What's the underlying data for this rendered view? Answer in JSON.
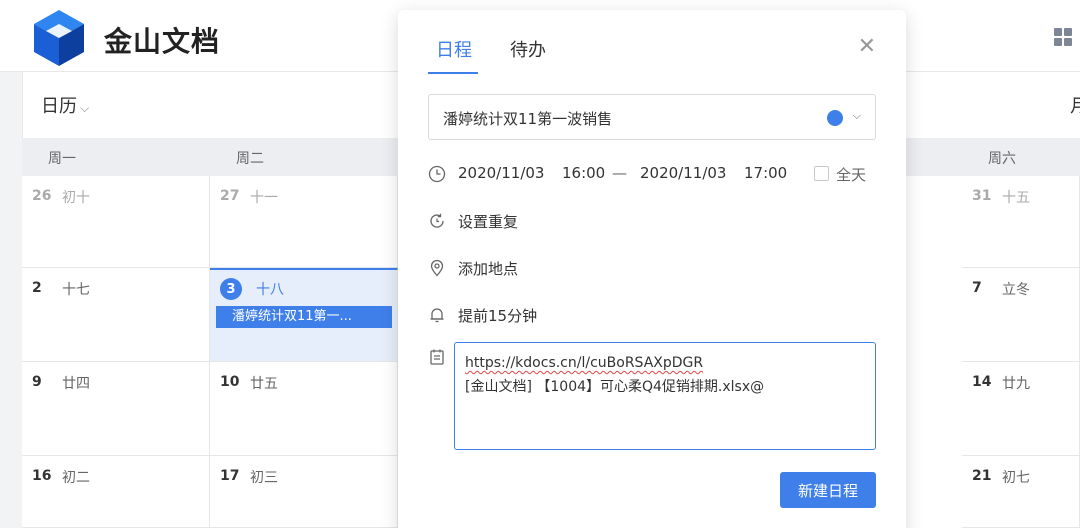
{
  "header": {
    "brand": "金山文档"
  },
  "calendar": {
    "view_label": "日历",
    "weekdays": [
      "周一",
      "周二",
      "周六"
    ],
    "right_edge_glyph": "月",
    "rows": [
      {
        "mon": {
          "date": "26",
          "lunar": "初十"
        },
        "tue": {
          "date": "27",
          "lunar": "十一"
        },
        "sat": {
          "date": "31",
          "lunar": "十五"
        }
      },
      {
        "mon": {
          "date": "2",
          "lunar": "十七"
        },
        "tue": {
          "date": "3",
          "lunar": "十八"
        },
        "sat": {
          "date": "7",
          "lunar": "立冬"
        }
      },
      {
        "mon": {
          "date": "9",
          "lunar": "廿四"
        },
        "tue": {
          "date": "10",
          "lunar": "廿五"
        },
        "sat": {
          "date": "14",
          "lunar": "廿九"
        }
      },
      {
        "mon": {
          "date": "16",
          "lunar": "初二"
        },
        "tue": {
          "date": "17",
          "lunar": "初三"
        },
        "sat": {
          "date": "21",
          "lunar": "初七"
        }
      }
    ],
    "event_chip": "潘婷统计双11第一..."
  },
  "dialog": {
    "tabs": [
      "日程",
      "待办"
    ],
    "title": "潘婷统计双11第一波销售",
    "start_date": "2020/11/03",
    "start_time": "16:00",
    "separator": "—",
    "end_date": "2020/11/03",
    "end_time": "17:00",
    "allday_label": "全天",
    "repeat_label": "设置重复",
    "location_label": "添加地点",
    "reminder_label": "提前15分钟",
    "notes_line1": "https://kdocs.cn/l/cuBoRSAXpDGR",
    "notes_line2": "[金山文档] 【1004】可心柔Q4促销排期.xlsx@",
    "create_button": "新建日程"
  },
  "colors": {
    "accent": "#3f7fea",
    "event_color": "#3f7fea"
  }
}
